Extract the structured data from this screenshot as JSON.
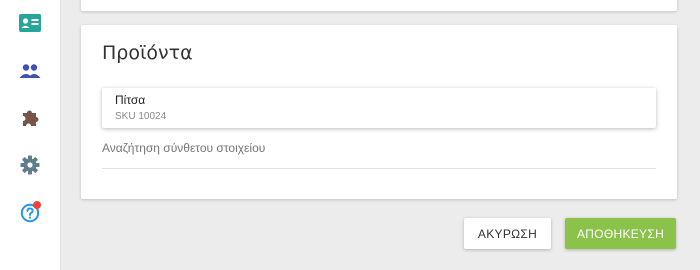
{
  "sidebar": {
    "items": [
      {
        "icon": "contact-card-icon",
        "color": "#26a69a"
      },
      {
        "icon": "people-icon",
        "color": "#3f51b5"
      },
      {
        "icon": "puzzle-icon",
        "color": "#795548"
      },
      {
        "icon": "gear-icon",
        "color": "#607d8b"
      },
      {
        "icon": "help-icon",
        "color": "#2196f3",
        "badge_color": "#f44336"
      }
    ]
  },
  "products": {
    "title": "Προϊόντα",
    "selected_item": {
      "name": "Πίτσα",
      "sku": "SKU 10024"
    },
    "search": {
      "placeholder": "Αναζήτηση σύνθετου στοιχείου",
      "value": ""
    }
  },
  "actions": {
    "cancel_label": "ΑΚΥΡΩΣΗ",
    "save_label": "ΑΠΟΘΗΚΕΥΣΗ"
  },
  "colors": {
    "save_button": "#8bc34a",
    "background": "#ececec"
  }
}
